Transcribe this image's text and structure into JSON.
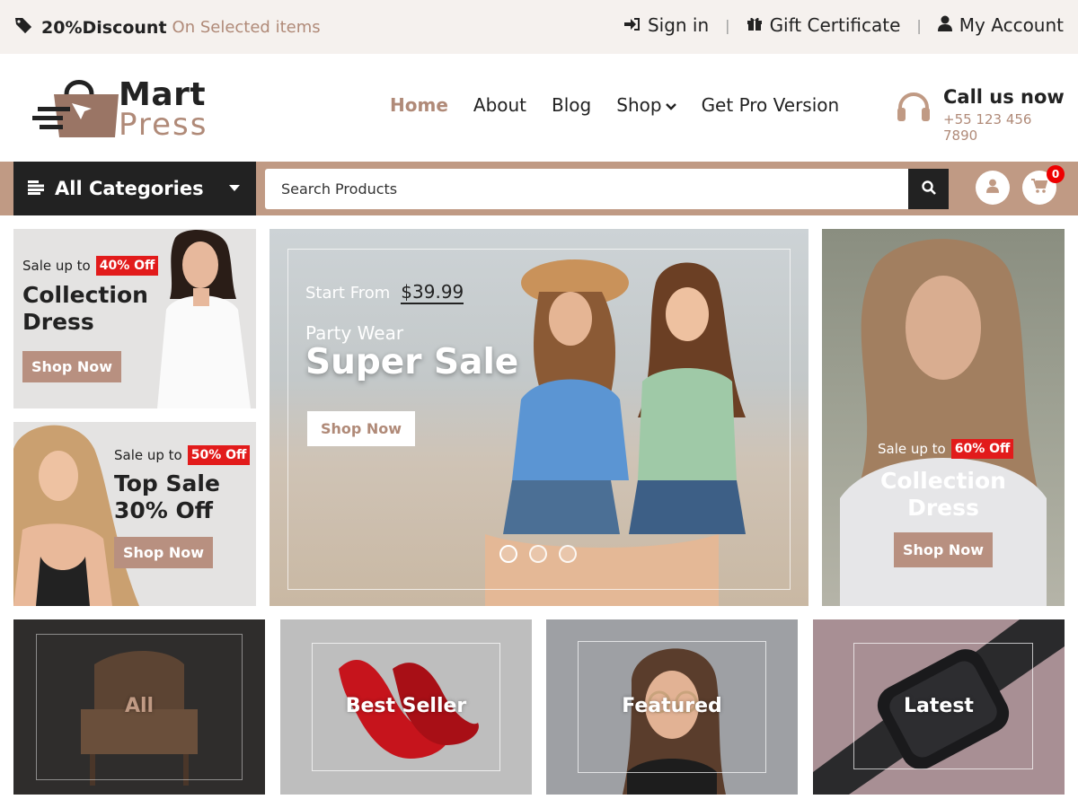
{
  "topbar": {
    "promo_bold": "20%Discount",
    "promo_rest": "On Selected items",
    "links": [
      {
        "label": "Sign in",
        "icon": "sign-in-icon"
      },
      {
        "label": "Gift Certificate",
        "icon": "gift-icon"
      },
      {
        "label": "My Account",
        "icon": "user-icon"
      }
    ],
    "separator": "|"
  },
  "logo": {
    "line1": "Mart",
    "line2": "Press"
  },
  "nav": {
    "items": [
      {
        "label": "Home",
        "active": true
      },
      {
        "label": "About"
      },
      {
        "label": "Blog"
      },
      {
        "label": "Shop",
        "dropdown": true
      },
      {
        "label": "Get Pro Version"
      }
    ]
  },
  "contact": {
    "title": "Call us now",
    "phone": "+55 123 456 7890"
  },
  "search": {
    "categories_label": "All Categories",
    "placeholder": "Search Products",
    "cart_count": "0"
  },
  "banners": {
    "left_top": {
      "sale_prefix": "Sale up to",
      "off": "40% Off",
      "title1": "Collection",
      "title2": "Dress",
      "button": "Shop Now"
    },
    "left_bottom": {
      "sale_prefix": "Sale up to",
      "off": "50% Off",
      "title1": "Top Sale",
      "title2": "30% Off",
      "button": "Shop Now"
    },
    "hero": {
      "start_from": "Start From",
      "price": "$39.99",
      "subtitle": "Party Wear",
      "title": "Super Sale",
      "button": "Shop Now",
      "slides": 3,
      "active_slide": 1
    },
    "right": {
      "sale_prefix": "Sale up to",
      "off": "60% Off",
      "title1": "Collection",
      "title2": "Dress",
      "button": "Shop Now"
    }
  },
  "tiles": [
    {
      "label": "All"
    },
    {
      "label": "Best Seller"
    },
    {
      "label": "Featured"
    },
    {
      "label": "Latest"
    }
  ],
  "colors": {
    "accent": "#b08a78",
    "dark": "#222222",
    "badge": "#e21b1b",
    "bar": "#c09a84"
  }
}
